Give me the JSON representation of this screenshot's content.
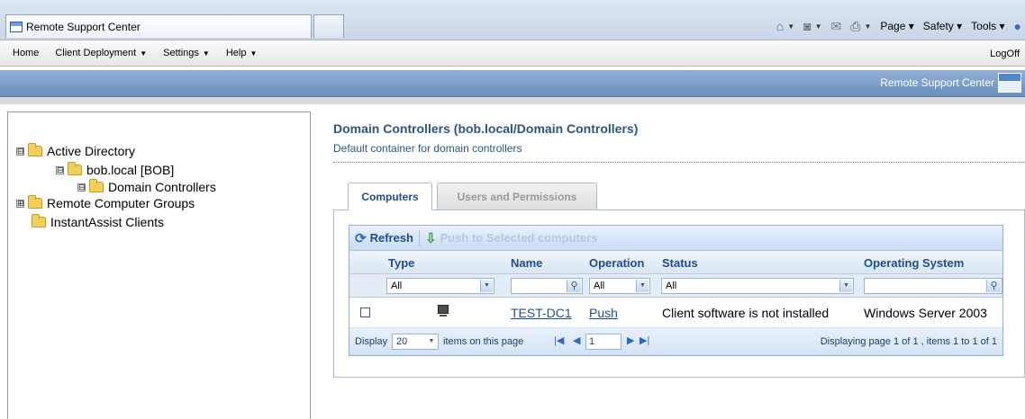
{
  "browser": {
    "tab_title": "Remote Support Center",
    "command_bar": {
      "page": "Page",
      "safety": "Safety",
      "tools": "Tools"
    }
  },
  "menu": {
    "items": [
      {
        "label": "Home",
        "dropdown": false
      },
      {
        "label": "Client Deployment",
        "dropdown": true
      },
      {
        "label": "Settings",
        "dropdown": true
      },
      {
        "label": "Help",
        "dropdown": true
      }
    ],
    "logoff": "LogOff"
  },
  "header": {
    "brand": "Remote Support Center"
  },
  "tree": {
    "nodes": [
      {
        "label": "Active Directory",
        "expander": "⊟"
      },
      {
        "label": "bob.local [BOB]",
        "expander": "⊟"
      },
      {
        "label": "Domain Controllers",
        "expander": "⊟"
      },
      {
        "label": "Remote Computer Groups",
        "expander": "⊞"
      },
      {
        "label": "InstantAssist Clients",
        "expander": ""
      }
    ]
  },
  "content": {
    "title": "Domain Controllers (bob.local/Domain Controllers)",
    "subtitle": "Default container for domain controllers"
  },
  "tabs": [
    {
      "label": "Computers",
      "active": true
    },
    {
      "label": "Users and Permissions",
      "active": false
    }
  ],
  "toolbar": {
    "refresh": "Refresh",
    "push": "Push to Selected computers"
  },
  "table": {
    "columns": [
      "Type",
      "Name",
      "Operation",
      "Status",
      "Operating System"
    ],
    "filters": {
      "type": "All",
      "operation": "All",
      "status": "All"
    },
    "rows": [
      {
        "name": "TEST-DC1",
        "operation": "Push",
        "status": "Client software is not installed",
        "os": "Windows Server 2003"
      }
    ]
  },
  "pager": {
    "display_label": "Display",
    "page_size": "20",
    "items_label": "items on this page",
    "page": "1",
    "summary": "Displaying page 1 of 1 , items 1 to 1 of 1"
  },
  "colors": {
    "accent": "#1f4f8a",
    "header_band": "#7a9cc8"
  }
}
